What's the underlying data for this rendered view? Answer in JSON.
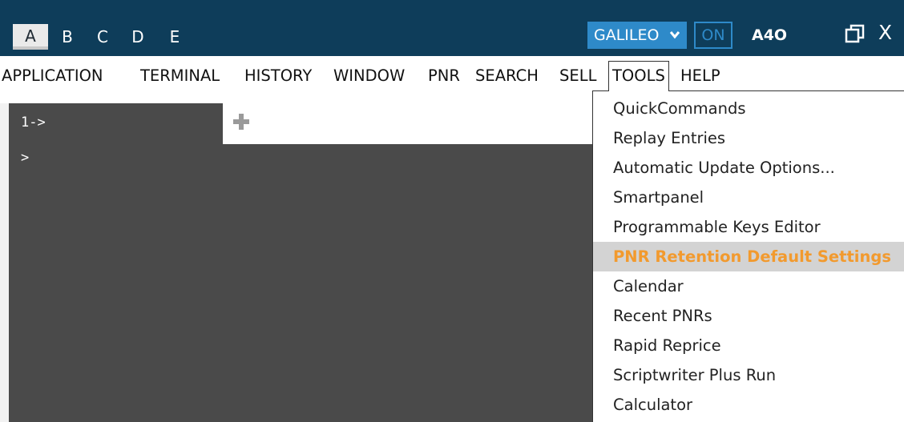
{
  "window_tabs": [
    "A",
    "B",
    "C",
    "D",
    "E"
  ],
  "gds": {
    "selected": "GALILEO",
    "chevron": "❯"
  },
  "status": {
    "on_label": "ON",
    "agent": "A4O"
  },
  "window_controls": {
    "close_glyph": "X"
  },
  "menu": [
    "APPLICATION",
    "TERMINAL",
    "HISTORY",
    "WINDOW",
    "PNR",
    "SEARCH",
    "SELL",
    "TOOLS",
    "HELP"
  ],
  "terminal": {
    "tab_label": "1->",
    "prompt": ">"
  },
  "tools_menu": {
    "items": [
      "QuickCommands",
      "Replay Entries",
      "Automatic Update Options...",
      "Smartpanel",
      "Programmable Keys Editor",
      "PNR Retention Default Settings",
      "Calendar",
      "Recent PNRs",
      "Rapid Reprice",
      "Scriptwriter Plus Run",
      "Calculator"
    ],
    "highlighted": "PNR Retention Default Settings"
  },
  "colors": {
    "titlebar": "#0e3d5a",
    "accent_blue": "#2e8ac9",
    "terminal_bg": "#4a4a4a",
    "highlight_text": "#f29a2e",
    "highlight_bg": "#d3d3d3"
  }
}
